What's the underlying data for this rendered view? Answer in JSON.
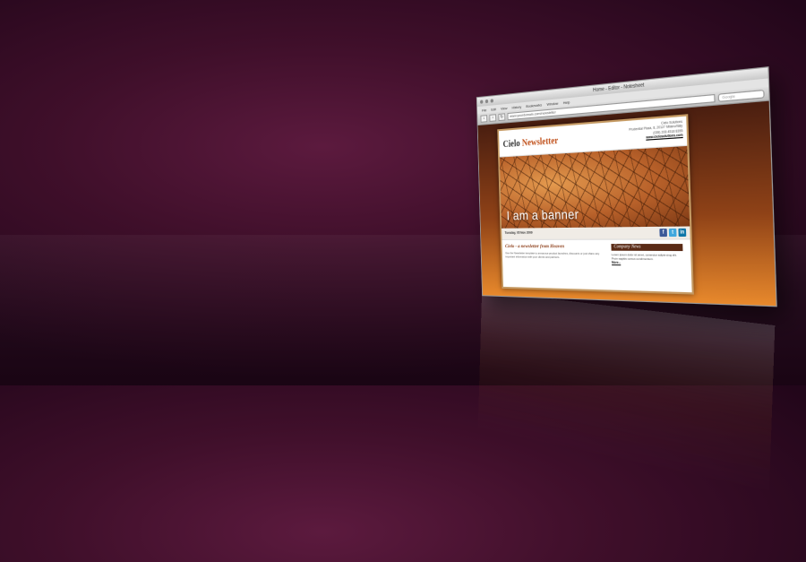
{
  "browser": {
    "window_title": "Home - Editor - Notesheet",
    "menu_items": [
      "File",
      "Edit",
      "View",
      "History",
      "Bookmarks",
      "Window",
      "Help"
    ],
    "url": "www.yourdomain.com/newsletter",
    "search_placeholder": "Google"
  },
  "newsletter": {
    "title_part1": "Cielo",
    "title_part2": "Newsletter",
    "contact": {
      "company": "Cielo Solutions",
      "address": "Prudential Plaza, 8, 20127 Milano/Italy",
      "phone": "(039) 208 4518 8355",
      "website": "www.cielosolutions.com"
    },
    "banner_text": "I am a banner",
    "date": "Tuesday, 05 Nov 2009",
    "social": {
      "facebook": "f",
      "twitter": "t",
      "linkedin": "in"
    },
    "article": {
      "heading": "Cielo - a newsletter from Heaven",
      "body": "Use the Newsletter template to announce product launches, discounts or just share any important information with your clients and partners."
    },
    "company_news": {
      "heading": "Company News",
      "body": "Lorem ipsum dolor sit amet, consectur adipis-cing elit. Proin sagittis cursus condimentum.",
      "more": "More..."
    }
  }
}
